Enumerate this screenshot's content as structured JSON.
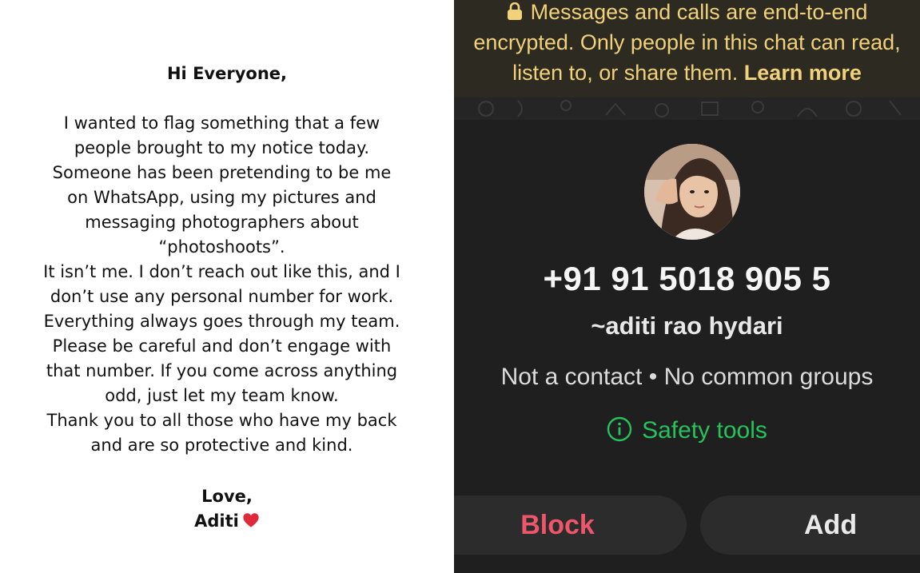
{
  "note": {
    "greeting": "Hi Everyone,",
    "body_lines": [
      "I wanted to flag something that a few",
      "people brought to my notice today.",
      "Someone has been pretending to be me",
      "on WhatsApp, using my pictures and",
      "messaging photographers about",
      "“photoshoots”.",
      "It isn’t me. I don’t reach out like this, and I",
      "don’t use any personal number for work.",
      "Everything always goes through my team.",
      "Please be careful and don’t engage with",
      "that number. If you come across anything",
      "odd, just let my team know.",
      "Thank you to all those who have my back",
      "and are so protective and kind."
    ],
    "signoff": "Love,",
    "signature": "Aditi",
    "heart_icon": "heart-icon",
    "heart_color": "#e0293b"
  },
  "chat_profile": {
    "encryption_lines": [
      "Messages and calls are end-to-end",
      "encrypted. Only people in this chat can read,",
      "listen to, or share them."
    ],
    "learn_more": "Learn more",
    "lock_icon": "lock-icon",
    "banner_text_color": "#f1d27a",
    "phone_number": "+91 91 5018 905 5",
    "push_name": "~aditi rao hydari",
    "contact_status": "Not a contact",
    "separator": "•",
    "groups_status": "No common groups",
    "safety_tools": "Safety tools",
    "safety_color": "#26c25c",
    "block_label": "Block",
    "block_color": "#f0566a",
    "add_label": "Add"
  }
}
